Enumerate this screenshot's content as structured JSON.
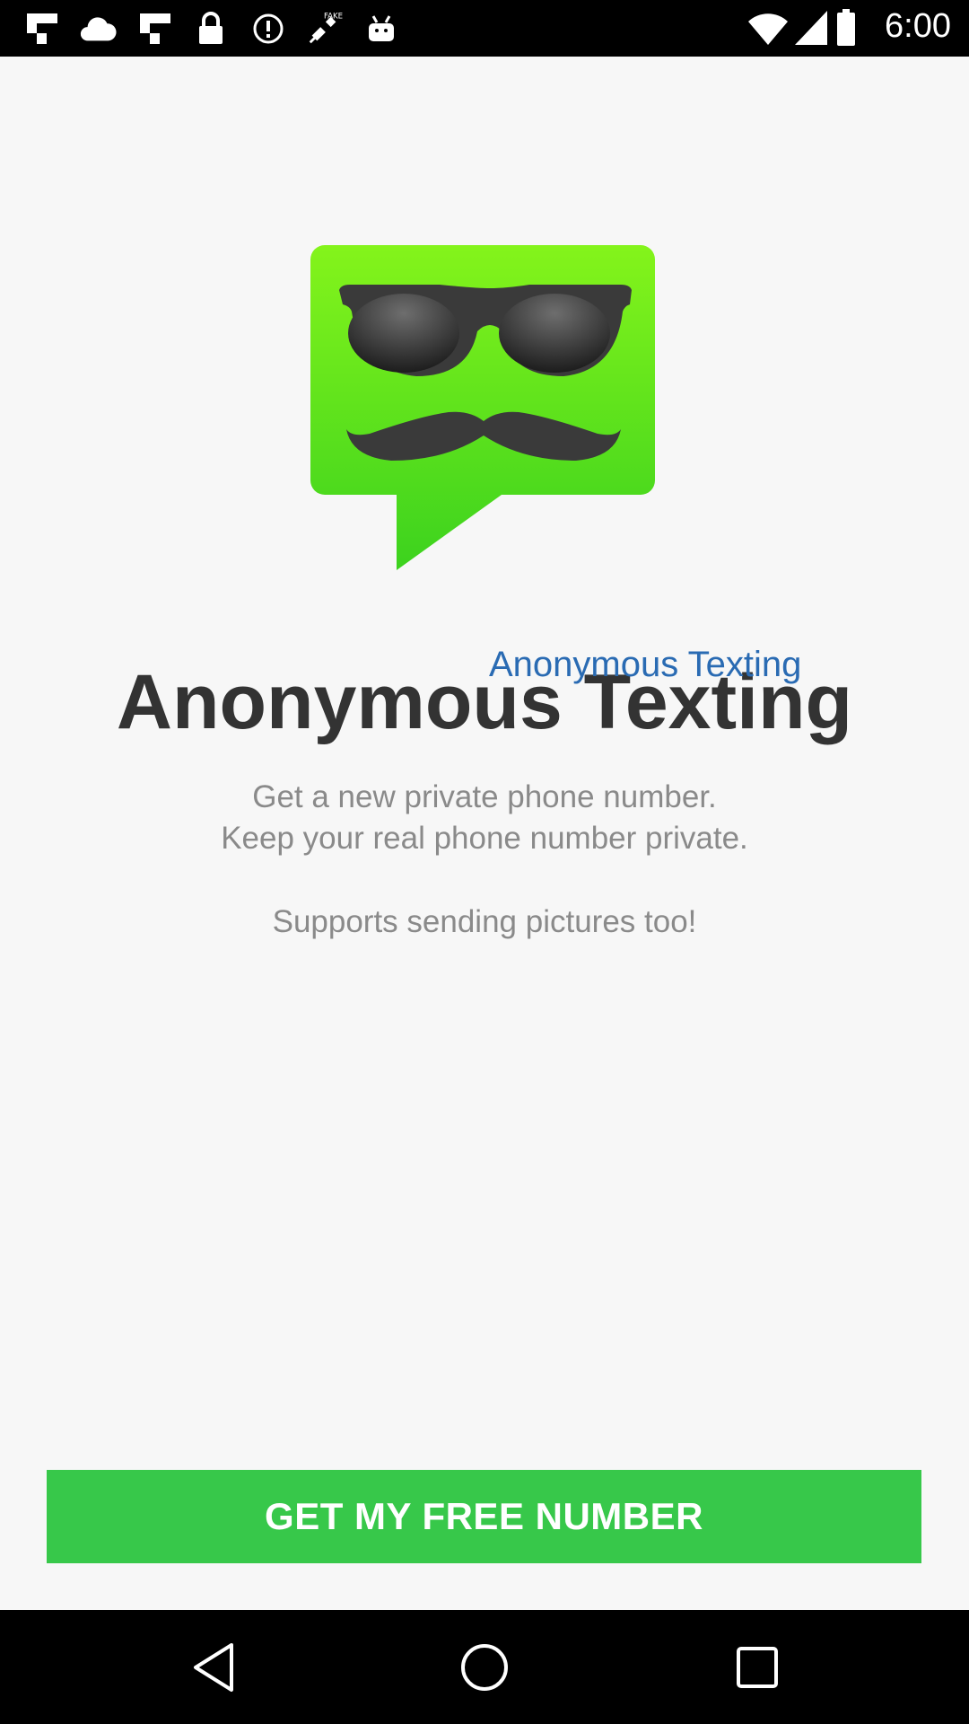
{
  "status_bar": {
    "time": "6:00",
    "icons": [
      "flipboard-icon",
      "cloud-icon",
      "flipboard-icon",
      "lock-icon",
      "alert-circle-icon",
      "fake-gps-icon",
      "android-icon"
    ],
    "right_icons": [
      "wifi-icon",
      "signal-icon",
      "battery-icon"
    ]
  },
  "app": {
    "title_overlay": "Anonymous Texting",
    "title": "Anonymous Texting",
    "description_line1": "Get a new private phone number.",
    "description_line2": "Keep your real phone number private.",
    "description_line3": "Supports sending pictures too!",
    "cta_label": "GET MY FREE NUMBER",
    "logo_icon": "anonymous-chat-logo-icon"
  },
  "colors": {
    "accent_green": "#37c84a",
    "logo_green": "#4ed623",
    "overlay_text_blue": "#2a6bb3",
    "title_text": "#333333",
    "body_text": "#8a8a8a"
  },
  "nav_bar": {
    "buttons": [
      "back-icon",
      "home-icon",
      "recents-icon"
    ]
  }
}
